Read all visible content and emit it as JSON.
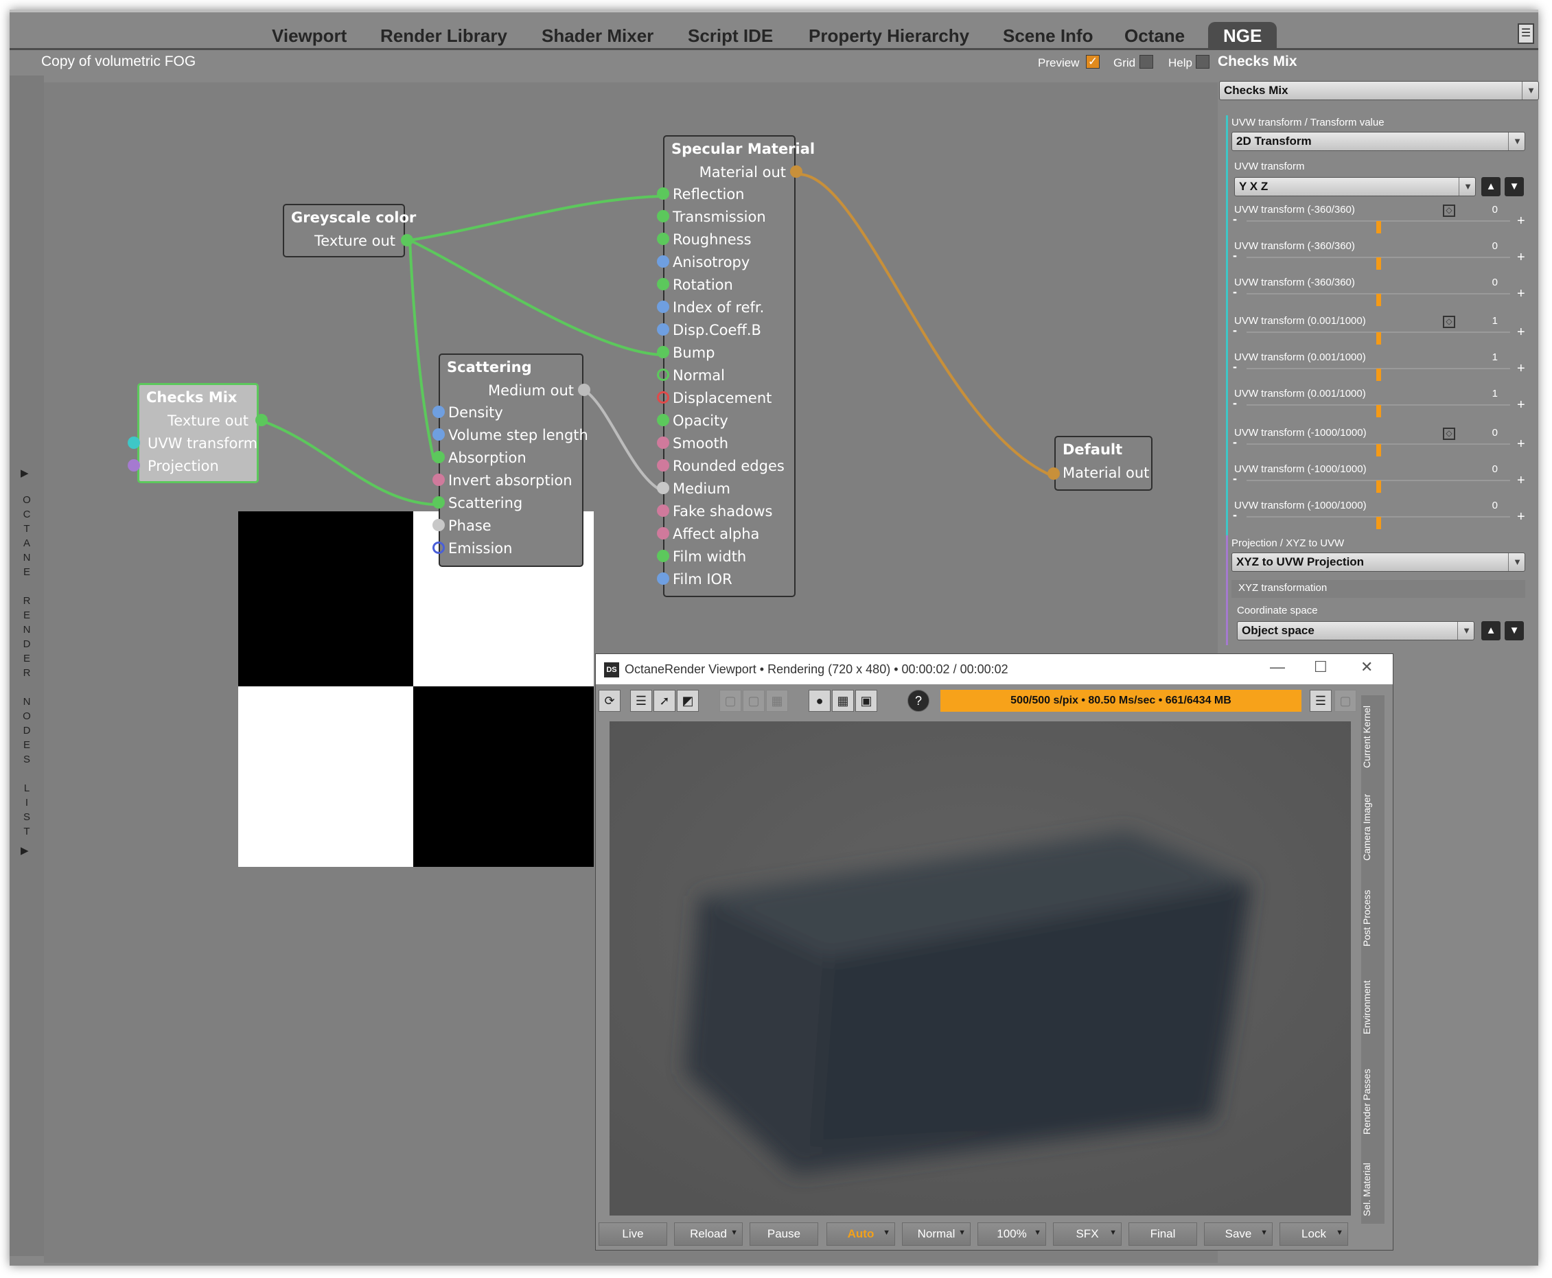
{
  "tabs": [
    "Viewport",
    "Render Library",
    "Shader Mixer",
    "Script IDE",
    "Property Hierarchy",
    "Scene Info",
    "Octane",
    "NGE"
  ],
  "active_tab": "NGE",
  "graph_title": "Copy of volumetric FOG",
  "options": {
    "preview": "Preview",
    "preview_checked": true,
    "grid": "Grid",
    "help": "Help"
  },
  "panel_title": "Checks Mix",
  "sidebar_label": "OCTANE RENDER NODES LIST",
  "nodes": {
    "checks": {
      "title": "Checks Mix",
      "out": "Texture out",
      "in": [
        "UVW transform",
        "Projection"
      ]
    },
    "grey": {
      "title": "Greyscale color",
      "out": "Texture out"
    },
    "scattering": {
      "title": "Scattering",
      "out": "Medium out",
      "in": [
        "Density",
        "Volume step length",
        "Absorption",
        "Invert absorption",
        "Scattering",
        "Phase",
        "Emission"
      ]
    },
    "specular": {
      "title": "Specular Material",
      "out": "Material out",
      "in": [
        "Reflection",
        "Transmission",
        "Roughness",
        "Anisotropy",
        "Rotation",
        "Index of refr.",
        "Disp.Coeff.B",
        "Bump",
        "Normal",
        "Displacement",
        "Opacity",
        "Smooth",
        "Rounded edges",
        "Medium",
        "Fake shadows",
        "Affect alpha",
        "Film width",
        "Film IOR"
      ]
    },
    "default": {
      "title": "Default",
      "out": "Material out"
    }
  },
  "properties": {
    "header_select": "Checks Mix",
    "uvw_group": "UVW transform / Transform value",
    "uvw_type": "2D Transform",
    "uvw_transform_label": "UVW transform",
    "axis_order": "Y X Z",
    "params": [
      {
        "label": "UVW transform (-360/360)",
        "value": "0",
        "key": true,
        "fraction": 0.5
      },
      {
        "label": "UVW transform (-360/360)",
        "value": "0",
        "key": false,
        "fraction": 0.5
      },
      {
        "label": "UVW transform (-360/360)",
        "value": "0",
        "key": false,
        "fraction": 0.5
      },
      {
        "label": "UVW transform (0.001/1000)",
        "value": "1",
        "key": true,
        "fraction": 0.5
      },
      {
        "label": "UVW transform (0.001/1000)",
        "value": "1",
        "key": false,
        "fraction": 0.5
      },
      {
        "label": "UVW transform (0.001/1000)",
        "value": "1",
        "key": false,
        "fraction": 0.5
      },
      {
        "label": "UVW transform (-1000/1000)",
        "value": "0",
        "key": true,
        "fraction": 0.5
      },
      {
        "label": "UVW transform (-1000/1000)",
        "value": "0",
        "key": false,
        "fraction": 0.5
      },
      {
        "label": "UVW transform (-1000/1000)",
        "value": "0",
        "key": false,
        "fraction": 0.5
      }
    ],
    "projection_group": "Projection / XYZ to UVW",
    "projection_type": "XYZ to UVW Projection",
    "xyz_transformation": "XYZ transformation",
    "coordinate_space_label": "Coordinate space",
    "coordinate_space": "Object space"
  },
  "render_viewport": {
    "title": "OctaneRender Viewport • Rendering (720 x 480) • 00:00:02 / 00:00:02",
    "stats": "500/500 s/pix • 80.50 Ms/sec • 661/6434 MB",
    "side_tabs": [
      "Current Kernel",
      "Camera Imager",
      "Post Process",
      "Environment",
      "Render Passes",
      "Sel. Material"
    ],
    "buttons": [
      "Live",
      "Reload",
      "Pause",
      "Auto",
      "Normal",
      "100%",
      "SFX",
      "Final",
      "Save",
      "Lock"
    ],
    "active_button": "Auto"
  },
  "colors": {
    "accent": "#f59a16",
    "wire_green": "#5cc85c",
    "wire_orange": "#c8903a",
    "wire_grey": "#bcbcbc",
    "pin_blue": "#6f9fe0",
    "pin_pink": "#d07a9c",
    "pin_red": "#e04a4a",
    "pin_cyan": "#3ec7c7",
    "pin_purple": "#a57ad0"
  }
}
